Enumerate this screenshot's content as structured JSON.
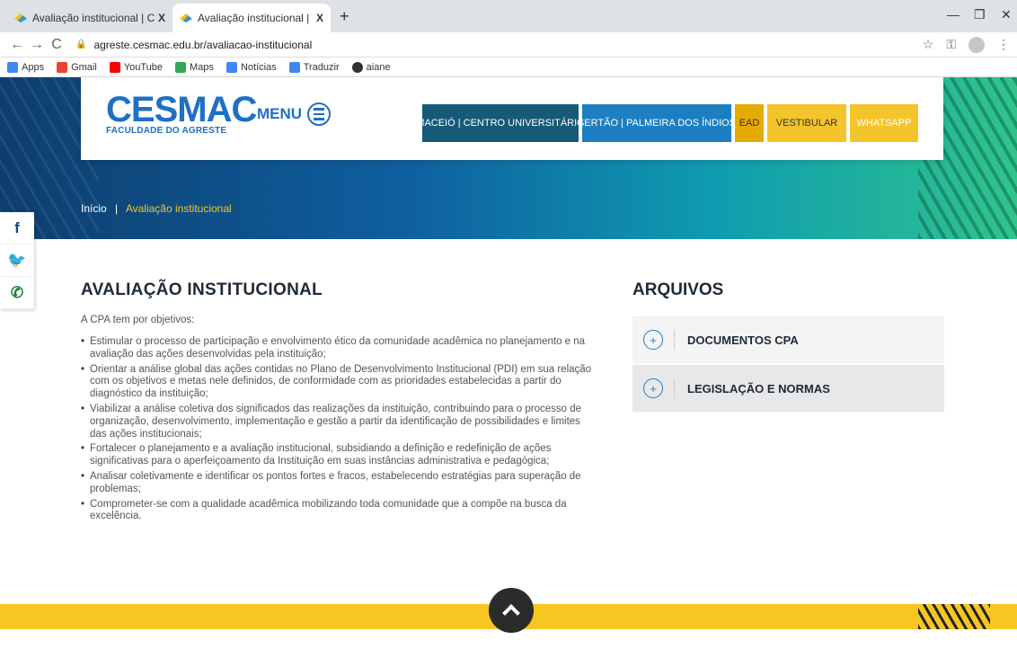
{
  "browser": {
    "tabs": [
      {
        "title": "Avaliação institucional | Cesmac",
        "close": "X"
      },
      {
        "title": "Avaliação institucional | Faculdad",
        "close": "X"
      }
    ],
    "new_tab": "+",
    "url": "agreste.cesmac.edu.br/avaliacao-institucional",
    "bookmarks": [
      {
        "label": "Apps",
        "color": "#4285f4"
      },
      {
        "label": "Gmail",
        "color": "#ea4335"
      },
      {
        "label": "YouTube",
        "color": "#ff0000"
      },
      {
        "label": "Maps",
        "color": "#34a853"
      },
      {
        "label": "Notícias",
        "color": "#4285f4"
      },
      {
        "label": "Traduzir",
        "color": "#4285f4"
      },
      {
        "label": "aiane",
        "color": "#333333"
      }
    ]
  },
  "header": {
    "logo_main": "CESMAC",
    "logo_sub": "FACULDADE DO AGRESTE",
    "menu_label": "MENU",
    "nav": [
      "MACEIÓ | CENTRO UNIVERSITÁRIO",
      "SERTÃO | PALMEIRA DOS ÍNDIOS",
      "EAD",
      "VESTIBULAR",
      "WHATSAPP"
    ]
  },
  "breadcrumb": {
    "home": "Início",
    "sep": "|",
    "current": "Avaliação institucional"
  },
  "main": {
    "title": "AVALIAÇÃO INSTITUCIONAL",
    "intro": "A CPA tem por objetivos:",
    "items": [
      "Estimular o processo de participação e envolvimento ético da comunidade acadêmica no planejamento e na avaliação das ações desenvolvidas pela instituição;",
      "Orientar a análise global das ações contidas no Plano de Desenvolvimento Institucional (PDI) em sua relação com os objetivos e metas nele definidos, de conformidade com as prioridades estabelecidas a partir do diagnóstico da instituição;",
      "Viabilizar a análise coletiva dos significados das realizações da instituição, contribuindo para o processo de organização, desenvolvimento, implementação e gestão a partir da identificação de possibilidades e limites das ações institucionais;",
      "Fortalecer o planejamento e a avaliação institucional, subsidiando a definição e redefinição de ações significativas para o aperfeiçoamento da Instituição em suas instâncias administrativa e pedagógica;",
      "Analisar coletivamente e identificar os pontos fortes e fracos, estabelecendo estratégias para superação de problemas;",
      "Comprometer-se com a qualidade acadêmica mobilizando toda comunidade que a compõe na busca da excelência."
    ]
  },
  "aside": {
    "title": "ARQUIVOS",
    "items": [
      "DOCUMENTOS CPA",
      "LEGISLAÇÃO E NORMAS"
    ]
  },
  "colors": {
    "brand_blue": "#1f6fc5",
    "yellow": "#f4c52a"
  }
}
